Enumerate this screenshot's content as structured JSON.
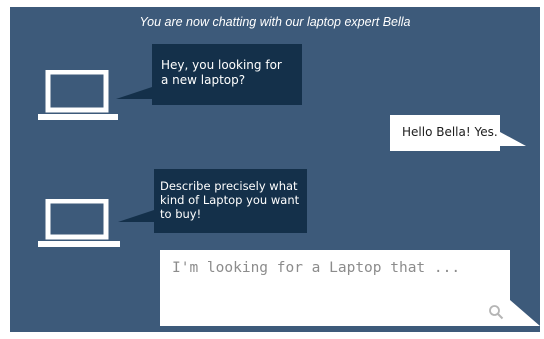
{
  "header": {
    "title": "You are now chatting with our laptop expert Bella"
  },
  "messages": [
    {
      "sender": "bot",
      "avatar_icon": "laptop-icon",
      "text_lines": [
        "Hey, you looking for",
        "a new laptop?"
      ]
    },
    {
      "sender": "user",
      "text": "Hello Bella! Yes."
    },
    {
      "sender": "bot",
      "avatar_icon": "laptop-icon",
      "text_lines": [
        "Describe precisely what",
        "kind of Laptop you want",
        "to buy!"
      ]
    }
  ],
  "input": {
    "placeholder": "I'm looking for a Laptop that ...",
    "value": "",
    "icon": "search-icon"
  },
  "colors": {
    "panel": "#3d5a7a",
    "bot_bubble": "#14304a",
    "user_bubble": "#ffffff",
    "text_light": "#ffffff"
  }
}
